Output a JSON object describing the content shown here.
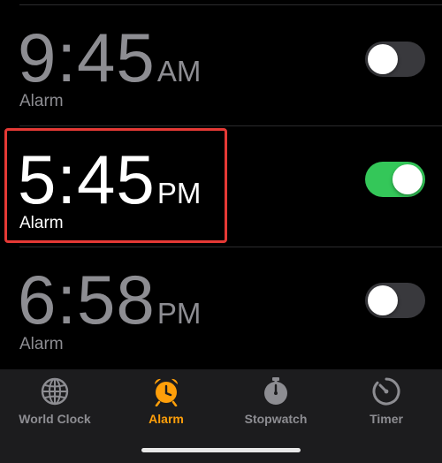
{
  "alarms": [
    {
      "time": "9:45",
      "period": "AM",
      "label": "Alarm",
      "enabled": false
    },
    {
      "time": "5:45",
      "period": "PM",
      "label": "Alarm",
      "enabled": true
    },
    {
      "time": "6:58",
      "period": "PM",
      "label": "Alarm",
      "enabled": false
    }
  ],
  "tab_bar": {
    "tabs": [
      {
        "label": "World Clock",
        "icon": "globe-icon",
        "active": false
      },
      {
        "label": "Alarm",
        "icon": "alarm-clock-icon",
        "active": true
      },
      {
        "label": "Stopwatch",
        "icon": "stopwatch-icon",
        "active": false
      },
      {
        "label": "Timer",
        "icon": "timer-icon",
        "active": false
      }
    ]
  },
  "colors": {
    "background": "#000000",
    "accent": "#ff9f0a",
    "toggle_on": "#34c759",
    "toggle_off": "#39393d",
    "highlight": "#e53935",
    "inactive_text": "#8d8d92"
  }
}
